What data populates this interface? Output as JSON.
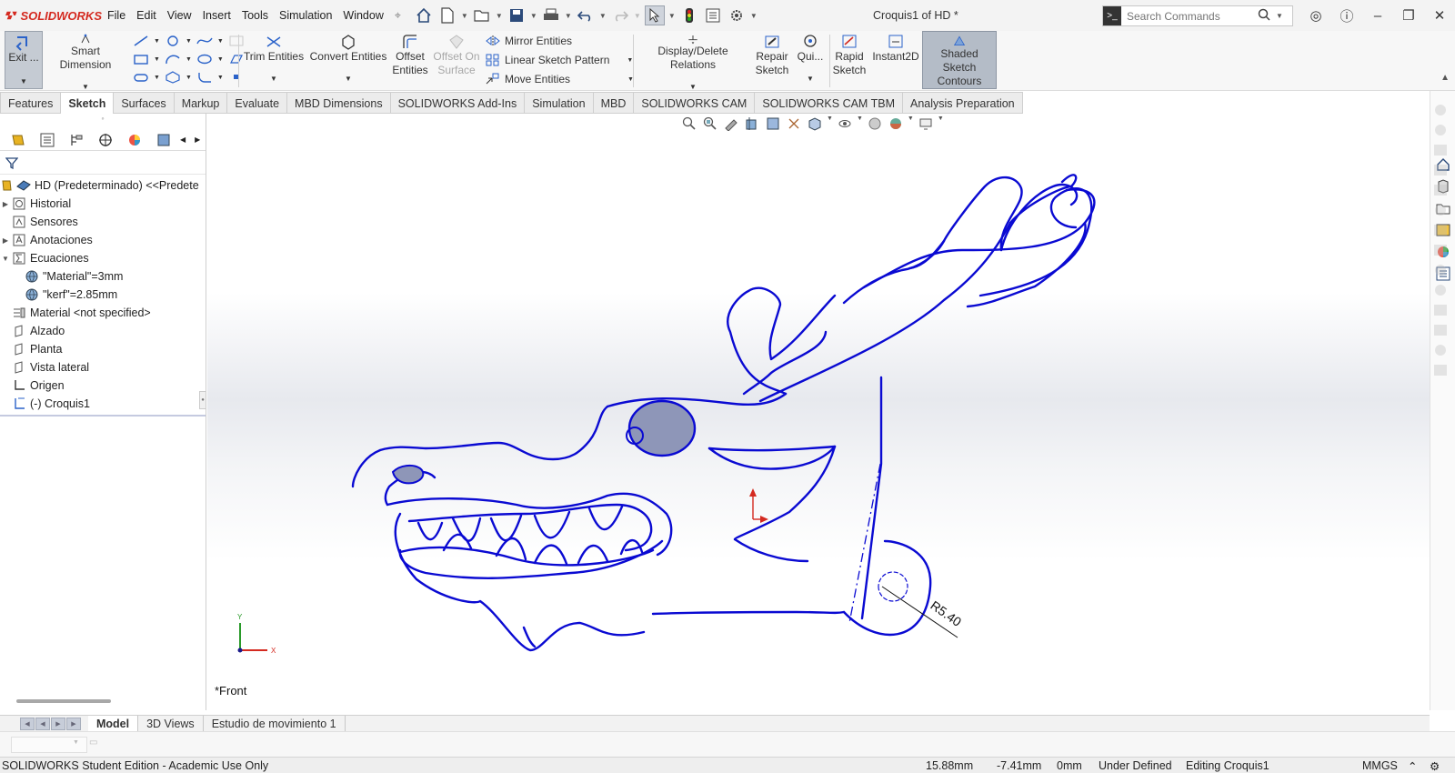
{
  "app": {
    "brand": "SOLIDWORKS",
    "doc_title": "Croquis1 of HD *",
    "menu": [
      "File",
      "Edit",
      "View",
      "Insert",
      "Tools",
      "Simulation",
      "Window"
    ],
    "search_placeholder": "Search Commands",
    "brand_color": "#d42a20"
  },
  "ribbon": {
    "exit": "Exit ...",
    "smart_dimension": "Smart Dimension",
    "trim": "Trim Entities",
    "convert": "Convert Entities",
    "offset_1": "Offset",
    "offset_2": "Entities",
    "offset_surface_1": "Offset On",
    "offset_surface_2": "Surface",
    "mirror": "Mirror Entities",
    "linear_pattern": "Linear Sketch Pattern",
    "move": "Move Entities",
    "display_relations": "Display/Delete Relations",
    "repair_1": "Repair",
    "repair_2": "Sketch",
    "quick": "Qui...",
    "rapid_1": "Rapid",
    "rapid_2": "Sketch",
    "instant2d": "Instant2D",
    "shaded_1": "Shaded Sketch",
    "shaded_2": "Contours"
  },
  "tabs": [
    "Features",
    "Sketch",
    "Surfaces",
    "Markup",
    "Evaluate",
    "MBD Dimensions",
    "SOLIDWORKS Add-Ins",
    "Simulation",
    "MBD",
    "SOLIDWORKS CAM",
    "SOLIDWORKS CAM TBM",
    "Analysis Preparation"
  ],
  "active_tab": "Sketch",
  "tree": {
    "root": "HD (Predeterminado) <<Predete",
    "historial": "Historial",
    "sensores": "Sensores",
    "anotaciones": "Anotaciones",
    "ecuaciones": "Ecuaciones",
    "eq1": "\"Material\"=3mm",
    "eq2": "\"kerf\"=2.85mm",
    "material": "Material <not specified>",
    "alzado": "Alzado",
    "planta": "Planta",
    "lateral": "Vista lateral",
    "origen": "Origen",
    "croquis": "(-) Croquis1"
  },
  "canvas": {
    "view_name": "*Front",
    "dimension": "R5.40",
    "axis_x": "X",
    "axis_y": "Y",
    "sketch_color": "#0a0ad2"
  },
  "bottom_tabs": [
    "Model",
    "3D Views",
    "Estudio de movimiento 1"
  ],
  "status": {
    "edition": "SOLIDWORKS Student Edition - Academic Use Only",
    "x": "15.88mm",
    "y": "-7.41mm",
    "z": "0mm",
    "state": "Under Defined",
    "editing": "Editing Croquis1",
    "units": "MMGS"
  }
}
